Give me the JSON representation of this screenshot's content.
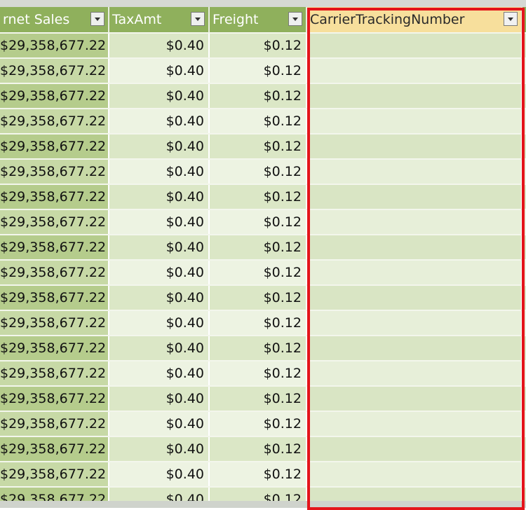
{
  "colors": {
    "header_bg": "#8fb05c",
    "selected_header_bg": "#f7df9c",
    "highlight_border": "#e4141b"
  },
  "columns": [
    {
      "label": "rnet Sales"
    },
    {
      "label": "TaxAmt"
    },
    {
      "label": "Freight"
    },
    {
      "label": "CarrierTrackingNumber",
      "selected": true
    },
    {
      "label": ""
    }
  ],
  "rows": [
    {
      "net_sales": "$29,358,677.22",
      "tax": "$0.40",
      "freight": "$0.12",
      "carrier": ""
    },
    {
      "net_sales": "$29,358,677.22",
      "tax": "$0.40",
      "freight": "$0.12",
      "carrier": ""
    },
    {
      "net_sales": "$29,358,677.22",
      "tax": "$0.40",
      "freight": "$0.12",
      "carrier": ""
    },
    {
      "net_sales": "$29,358,677.22",
      "tax": "$0.40",
      "freight": "$0.12",
      "carrier": ""
    },
    {
      "net_sales": "$29,358,677.22",
      "tax": "$0.40",
      "freight": "$0.12",
      "carrier": ""
    },
    {
      "net_sales": "$29,358,677.22",
      "tax": "$0.40",
      "freight": "$0.12",
      "carrier": ""
    },
    {
      "net_sales": "$29,358,677.22",
      "tax": "$0.40",
      "freight": "$0.12",
      "carrier": ""
    },
    {
      "net_sales": "$29,358,677.22",
      "tax": "$0.40",
      "freight": "$0.12",
      "carrier": ""
    },
    {
      "net_sales": "$29,358,677.22",
      "tax": "$0.40",
      "freight": "$0.12",
      "carrier": ""
    },
    {
      "net_sales": "$29,358,677.22",
      "tax": "$0.40",
      "freight": "$0.12",
      "carrier": ""
    },
    {
      "net_sales": "$29,358,677.22",
      "tax": "$0.40",
      "freight": "$0.12",
      "carrier": ""
    },
    {
      "net_sales": "$29,358,677.22",
      "tax": "$0.40",
      "freight": "$0.12",
      "carrier": ""
    },
    {
      "net_sales": "$29,358,677.22",
      "tax": "$0.40",
      "freight": "$0.12",
      "carrier": ""
    },
    {
      "net_sales": "$29,358,677.22",
      "tax": "$0.40",
      "freight": "$0.12",
      "carrier": ""
    },
    {
      "net_sales": "$29,358,677.22",
      "tax": "$0.40",
      "freight": "$0.12",
      "carrier": ""
    },
    {
      "net_sales": "$29,358,677.22",
      "tax": "$0.40",
      "freight": "$0.12",
      "carrier": ""
    },
    {
      "net_sales": "$29,358,677.22",
      "tax": "$0.40",
      "freight": "$0.12",
      "carrier": ""
    },
    {
      "net_sales": "$29,358,677.22",
      "tax": "$0.40",
      "freight": "$0.12",
      "carrier": ""
    },
    {
      "net_sales": "$29,358,677.22",
      "tax": "$0.40",
      "freight": "$0.12",
      "carrier": ""
    }
  ]
}
